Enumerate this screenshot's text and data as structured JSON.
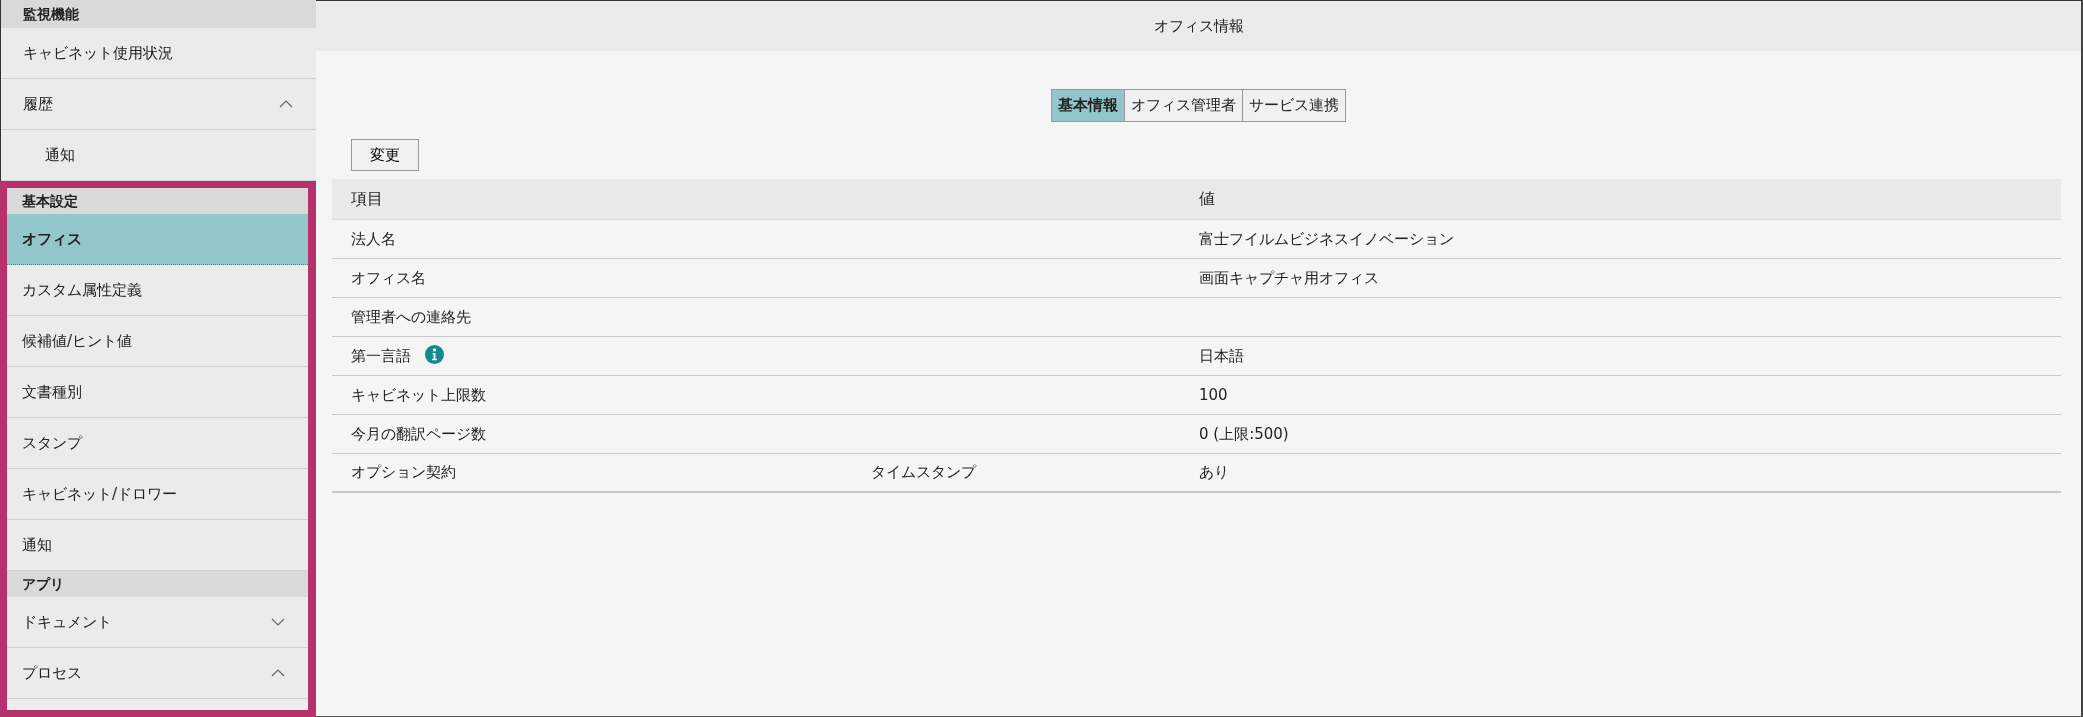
{
  "sidebar": {
    "sections": [
      {
        "title": "監視機能",
        "highlighted": false,
        "items": [
          {
            "label": "キャビネット使用状況",
            "selected": false
          },
          {
            "label": "履歴",
            "selected": false,
            "expanded": true,
            "children": [
              {
                "label": "通知",
                "selected": false
              }
            ]
          }
        ]
      },
      {
        "title": "基本設定",
        "highlighted": true,
        "items": [
          {
            "label": "オフィス",
            "selected": true
          },
          {
            "label": "カスタム属性定義",
            "selected": false
          },
          {
            "label": "候補値/ヒント値",
            "selected": false
          },
          {
            "label": "文書種別",
            "selected": false
          },
          {
            "label": "スタンプ",
            "selected": false
          },
          {
            "label": "キャビネット/ドロワー",
            "selected": false
          },
          {
            "label": "通知",
            "selected": false
          }
        ]
      },
      {
        "title": "アプリ",
        "highlighted": true,
        "items": [
          {
            "label": "ドキュメント",
            "selected": false,
            "expanded": false
          },
          {
            "label": "プロセス",
            "selected": false,
            "expanded": true
          }
        ]
      }
    ]
  },
  "header": {
    "title": "オフィス情報"
  },
  "tabs": [
    {
      "label": "基本情報",
      "selected": true
    },
    {
      "label": "オフィス管理者",
      "selected": false
    },
    {
      "label": "サービス連携",
      "selected": false
    }
  ],
  "edit_button": "変更",
  "table": {
    "columns": [
      "項目",
      "値"
    ],
    "rows": [
      {
        "item": "法人名",
        "value": "富士フイルムビジネスイノベーション"
      },
      {
        "item": "オフィス名",
        "value": "画面キャプチャ用オフィス"
      },
      {
        "item": "管理者への連絡先"
      },
      {
        "item": "第一言語",
        "info": true,
        "value": "日本語"
      },
      {
        "item": "キャビネット上限数",
        "value": "100"
      },
      {
        "item": "今月の翻訳ページ数",
        "value": "0 (上限:500)"
      },
      {
        "item": "オプション契約",
        "sub_item": "タイムスタンプ",
        "value": "あり"
      }
    ]
  }
}
